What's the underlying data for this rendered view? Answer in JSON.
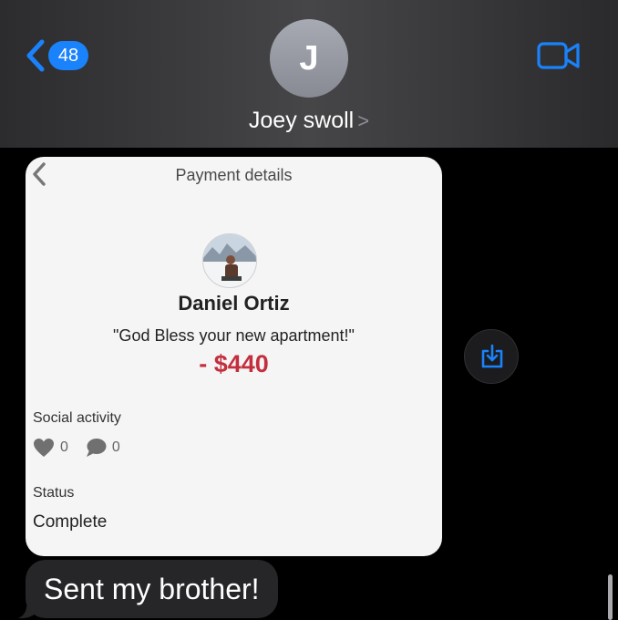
{
  "header": {
    "back_badge": "48",
    "avatar_initial": "J",
    "contact_name": "Joey swoll",
    "contact_chevron": ">"
  },
  "payment_card": {
    "title": "Payment details",
    "payer_name": "Daniel Ortiz",
    "note": "\"God Bless your new apartment!\"",
    "amount": "- $440",
    "social_label": "Social activity",
    "likes": "0",
    "comments": "0",
    "status_label": "Status",
    "status_value": "Complete"
  },
  "message": {
    "text": "Sent my brother!"
  },
  "colors": {
    "accent": "#1a82fb",
    "amount_red": "#c32f3f",
    "bubble_gray": "#262628"
  },
  "icons": [
    "back-chevron-icon",
    "video-camera-icon",
    "share-icon",
    "heart-icon",
    "comment-icon"
  ]
}
